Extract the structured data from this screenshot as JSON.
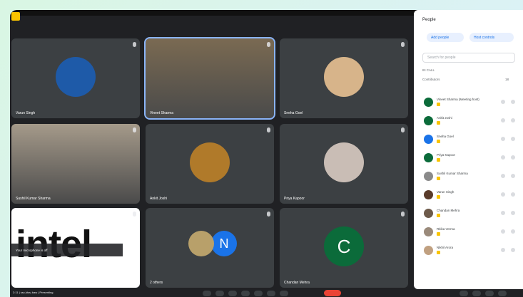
{
  "meeting": {
    "info": "2:11 | ssc-ktav-baw | Presenting",
    "notification": "!"
  },
  "participants_grid": [
    {
      "name": "Varun Singh",
      "kind": "avatar",
      "color": "#1e5aa8"
    },
    {
      "name": "Vineet Sharma",
      "kind": "video",
      "color": "#7a6a52",
      "active": true
    },
    {
      "name": "Sneha Goel",
      "kind": "avatar",
      "color": "#d7b48a"
    },
    {
      "name": "Sushil Kumar Sharma",
      "kind": "video",
      "color": "#a59a8a"
    },
    {
      "name": "Ankit Joshi",
      "kind": "avatar",
      "color": "#b07a2a"
    },
    {
      "name": "Priya Kapoor",
      "kind": "avatar",
      "color": "#c9bdb5"
    },
    {
      "name": "",
      "kind": "presentation",
      "logo": "intel"
    },
    {
      "name": "2 others",
      "kind": "group",
      "letter": "N",
      "color": "#1a73e8"
    },
    {
      "name": "Chandan Mehra",
      "kind": "letter",
      "letter": "C",
      "color": "#0b6b3a"
    }
  ],
  "caption": "Your microphone is off",
  "people_panel": {
    "title": "People",
    "add_label": "Add people",
    "host_label": "Host controls",
    "search_placeholder": "Search for people",
    "section": "IN CALL",
    "section_sub": "Contributors",
    "count": "18",
    "rows": [
      {
        "name": "Vineet Sharma (Meeting host)",
        "color": "#0b6b3a"
      },
      {
        "name": "Ankit Joshi",
        "color": "#0b6b3a"
      },
      {
        "name": "Sneha Goel",
        "color": "#1a73e8"
      },
      {
        "name": "Priya Kapoor",
        "color": "#0b6b3a"
      },
      {
        "name": "Sushil Kumar Sharma",
        "color": "#8a8a8a"
      },
      {
        "name": "Varun Singh",
        "color": "#5a3b2a"
      },
      {
        "name": "Chandan Mehra",
        "color": "#6d5a4a"
      },
      {
        "name": "Ritika Verma",
        "color": "#9a8a7a"
      },
      {
        "name": "Nikhil Arora",
        "color": "#c0a080"
      }
    ]
  }
}
